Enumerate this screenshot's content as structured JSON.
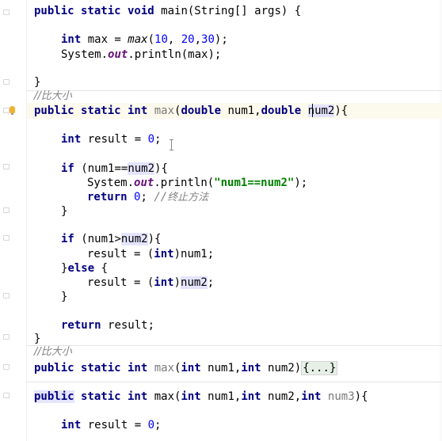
{
  "editor": {
    "lines": [
      {
        "t": "public static void main(String[] args) {"
      },
      {
        "t": "int max = max(10, 20,30);"
      },
      {
        "t": "System.out.println(max);"
      },
      {
        "t": "}"
      },
      {
        "t": "//比大小"
      },
      {
        "t": "public static int max(double num1,double num2){"
      },
      {
        "t": "int result = 0;"
      },
      {
        "t": "if (num1==num2){"
      },
      {
        "t": "System.out.println(\"num1==num2\");"
      },
      {
        "t": "return 0; //终止方法"
      },
      {
        "t": "}"
      },
      {
        "t": "if (num1>num2){"
      },
      {
        "t": "result = (int)num1;"
      },
      {
        "t": "}else {"
      },
      {
        "t": "result = (int)num2;"
      },
      {
        "t": "}"
      },
      {
        "t": "return result;"
      },
      {
        "t": "}"
      },
      {
        "t": "//比大小"
      },
      {
        "t": "public static int max(int num1,int num2){...}"
      },
      {
        "t": "public static int max(int num1,int num2,int num3){"
      },
      {
        "t": "int result = 0;"
      }
    ]
  },
  "colors": {
    "keyword": "#000080",
    "number": "#0000ff",
    "string": "#008000",
    "comment": "#808080",
    "static_field": "#660e7a",
    "current_line": "#fcfaed",
    "usage_highlight": "#e4e4ff"
  },
  "gutter": {
    "intention_icon": "lightbulb-icon",
    "fold_icon": "fold-marker-icon"
  }
}
